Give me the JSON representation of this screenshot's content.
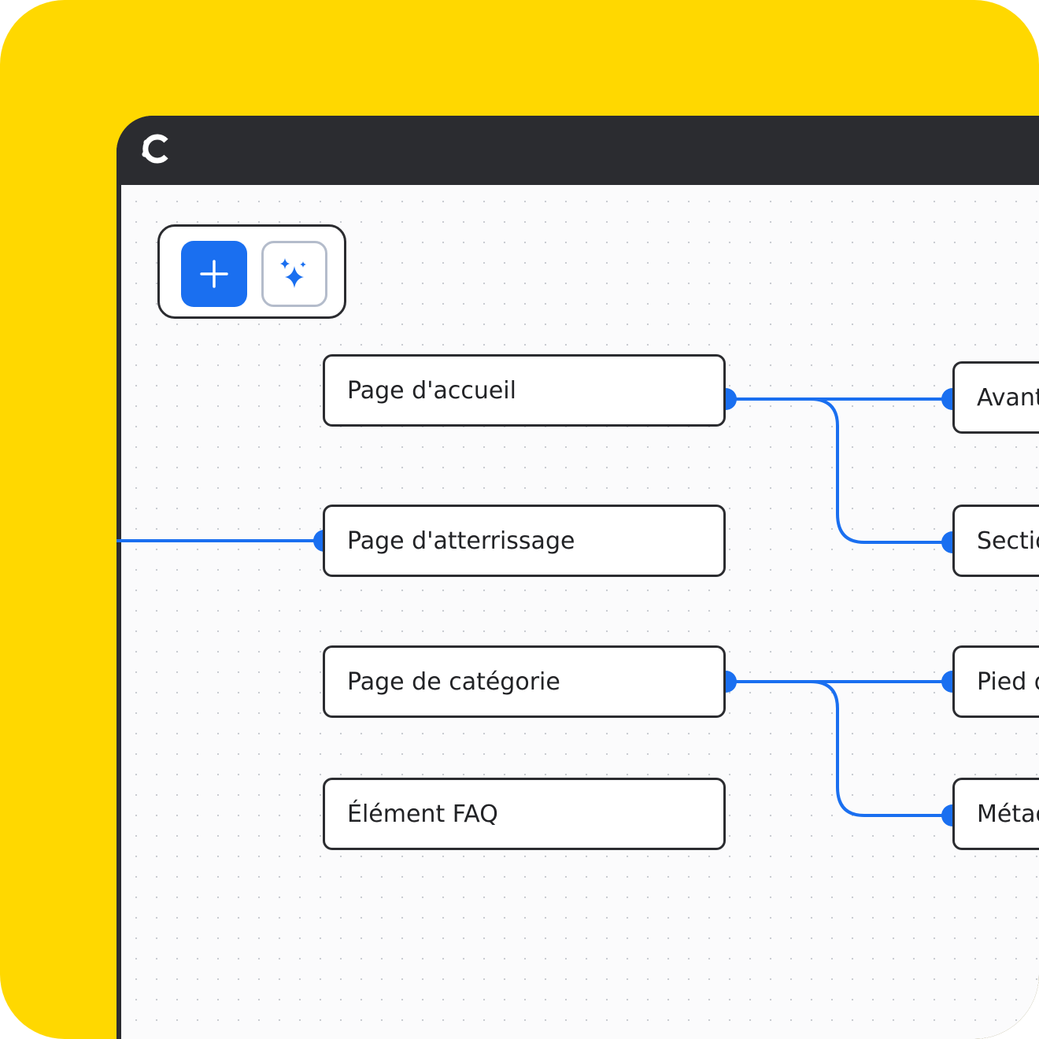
{
  "window": {
    "logo_icon": "app-logo-icon"
  },
  "toolbar": {
    "add_icon": "plus-icon",
    "ai_icon": "sparkles-icon"
  },
  "nodes_left": [
    {
      "label": "Page d'accueil"
    },
    {
      "label": "Page d'atterrissage"
    },
    {
      "label": "Page de catégorie"
    },
    {
      "label": "Élément FAQ"
    }
  ],
  "nodes_right": [
    {
      "label": "Avant"
    },
    {
      "label": "Sectio"
    },
    {
      "label": "Pied d"
    },
    {
      "label": "Métad"
    }
  ],
  "colors": {
    "background": "#FFD800",
    "window": "#2b2c30",
    "accent": "#1a6ff0"
  }
}
